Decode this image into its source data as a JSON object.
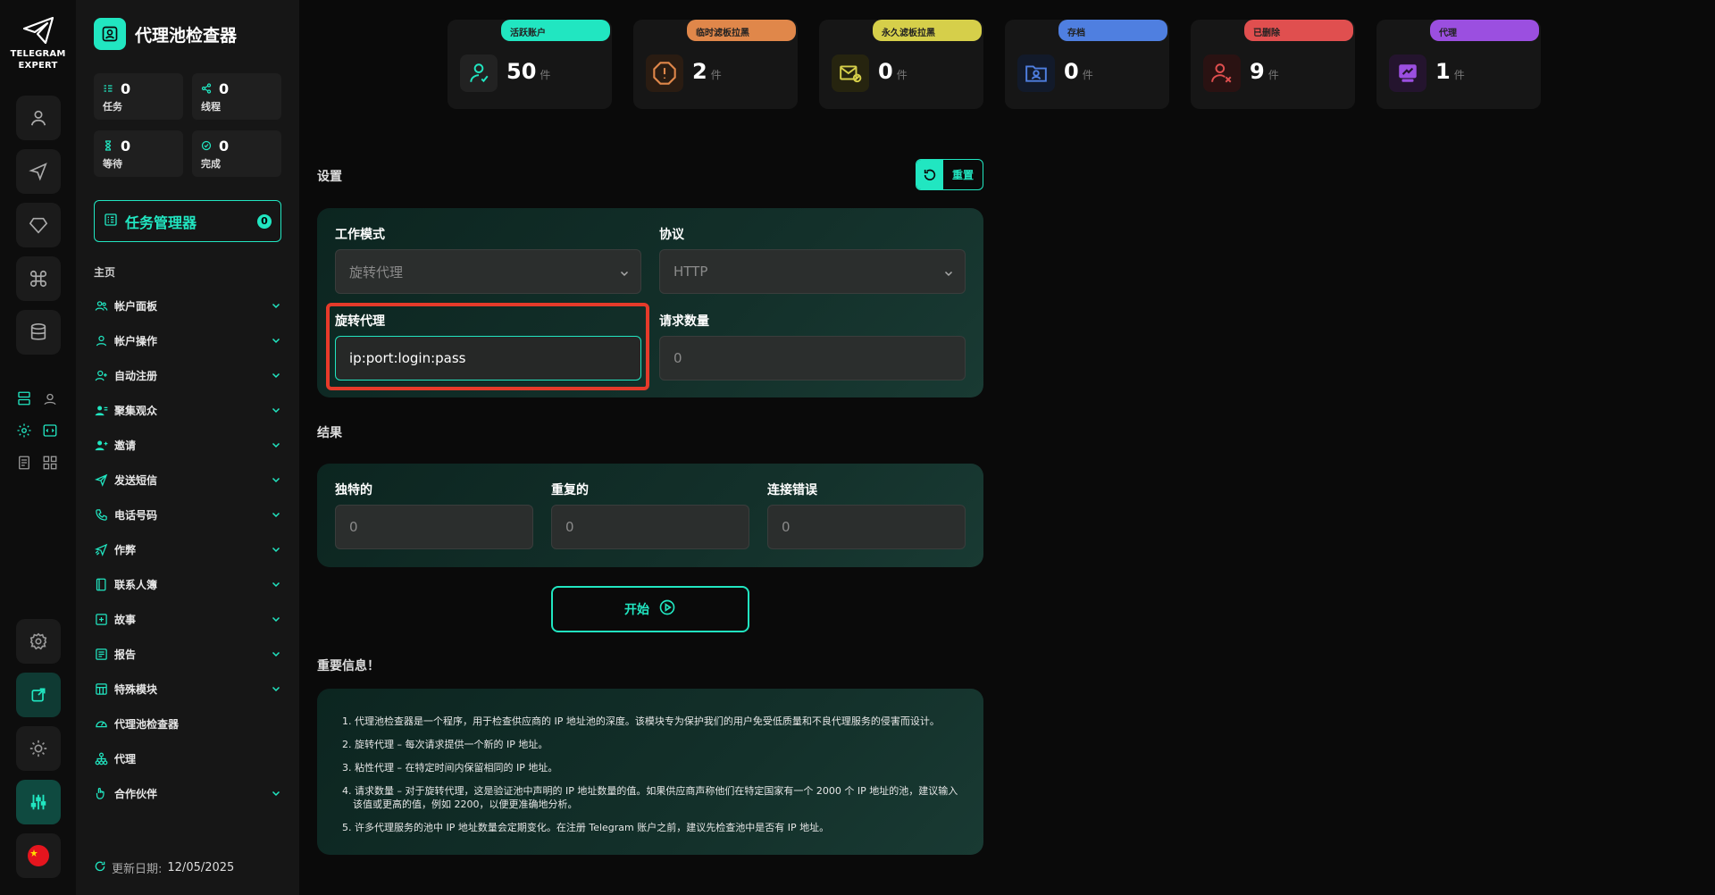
{
  "rail": {
    "logo_line1": "TELEGRAM",
    "logo_line2": "EXPERT",
    "items": [
      "user-icon",
      "send-icon",
      "diamond-icon",
      "command-icon",
      "database-icon"
    ],
    "bottom_items": [
      "settings-icon",
      "external-link-icon",
      "sun-icon",
      "sliders-icon",
      "china-flag-icon"
    ]
  },
  "sidebar": {
    "title": "代理池检查器",
    "stats": [
      {
        "value": "0",
        "label": "任务"
      },
      {
        "value": "0",
        "label": "线程"
      },
      {
        "value": "0",
        "label": "等待"
      },
      {
        "value": "0",
        "label": "完成"
      }
    ],
    "task_manager": {
      "label": "任务管理器",
      "count": "0"
    },
    "section": "主页",
    "nav": [
      {
        "label": "帐户面板",
        "icon": "users-icon",
        "expandable": true
      },
      {
        "label": "帐户操作",
        "icon": "user-icon",
        "expandable": true
      },
      {
        "label": "自动注册",
        "icon": "user-plus-icon",
        "expandable": true
      },
      {
        "label": "聚集观众",
        "icon": "audience-icon",
        "expandable": true
      },
      {
        "label": "邀请",
        "icon": "invite-icon",
        "expandable": true
      },
      {
        "label": "发送短信",
        "icon": "send-icon",
        "expandable": true
      },
      {
        "label": "电话号码",
        "icon": "phone-icon",
        "expandable": true
      },
      {
        "label": "作弊",
        "icon": "rocket-icon",
        "expandable": true
      },
      {
        "label": "联系人簿",
        "icon": "contacts-icon",
        "expandable": true
      },
      {
        "label": "故事",
        "icon": "plus-square-icon",
        "expandable": true
      },
      {
        "label": "报告",
        "icon": "report-icon",
        "expandable": true
      },
      {
        "label": "特殊模块",
        "icon": "module-icon",
        "expandable": true
      },
      {
        "label": "代理池检查器",
        "icon": "gauge-icon",
        "expandable": false
      },
      {
        "label": "代理",
        "icon": "network-icon",
        "expandable": false
      },
      {
        "label": "合作伙伴",
        "icon": "handshake-icon",
        "expandable": true
      }
    ],
    "update_label": "更新日期:",
    "update_date": "12/05/2025"
  },
  "top_cards": [
    {
      "pill": "活跃账户",
      "value": "50",
      "unit": "件",
      "color": "#21e6c1",
      "icon": "user-check-icon"
    },
    {
      "pill": "临时滤板拉黑",
      "value": "2",
      "unit": "件",
      "color": "#e0874a",
      "icon": "alert-icon"
    },
    {
      "pill": "永久滤板拉黑",
      "value": "0",
      "unit": "件",
      "color": "#d6cf4a",
      "icon": "mail-block-icon"
    },
    {
      "pill": "存档",
      "value": "0",
      "unit": "件",
      "color": "#4f7fe0",
      "icon": "archive-user-icon"
    },
    {
      "pill": "已删除",
      "value": "9",
      "unit": "件",
      "color": "#e04f4f",
      "icon": "user-x-icon"
    },
    {
      "pill": "代理",
      "value": "1",
      "unit": "件",
      "color": "#9b4fe0",
      "icon": "proxy-icon"
    }
  ],
  "settings": {
    "title": "设置",
    "reset_label": "重置",
    "work_mode_label": "工作模式",
    "work_mode_value": "旋转代理",
    "protocol_label": "协议",
    "protocol_value": "HTTP",
    "rotating_label": "旋转代理",
    "rotating_value": "ip:port:login:pass",
    "request_label": "请求数量",
    "request_placeholder": "0"
  },
  "results": {
    "title": "结果",
    "unique_label": "独特的",
    "unique_value": "0",
    "duplicate_label": "重复的",
    "duplicate_value": "0",
    "error_label": "连接错误",
    "error_value": "0"
  },
  "start_label": "开始",
  "info": {
    "title": "重要信息！",
    "items": [
      "1. 代理池检查器是一个程序，用于检查供应商的 IP 地址池的深度。该模块专为保护我们的用户免受低质量和不良代理服务的侵害而设计。",
      "2. 旋转代理 – 每次请求提供一个新的 IP 地址。",
      "3. 粘性代理 – 在特定时间内保留相同的 IP 地址。",
      "4. 请求数量 – 对于旋转代理，这是验证池中声明的 IP 地址数量的值。如果供应商声称他们在特定国家有一个 2000 个 IP 地址的池，建议输入该值或更高的值，例如 2200，以便更准确地分析。",
      "5. 许多代理服务的池中 IP 地址数量会定期变化。在注册 Telegram 账户之前，建议先检查池中是否有 IP 地址。"
    ]
  },
  "colors": {
    "accent": "#21e6c1",
    "highlight": "#e53a2a"
  }
}
